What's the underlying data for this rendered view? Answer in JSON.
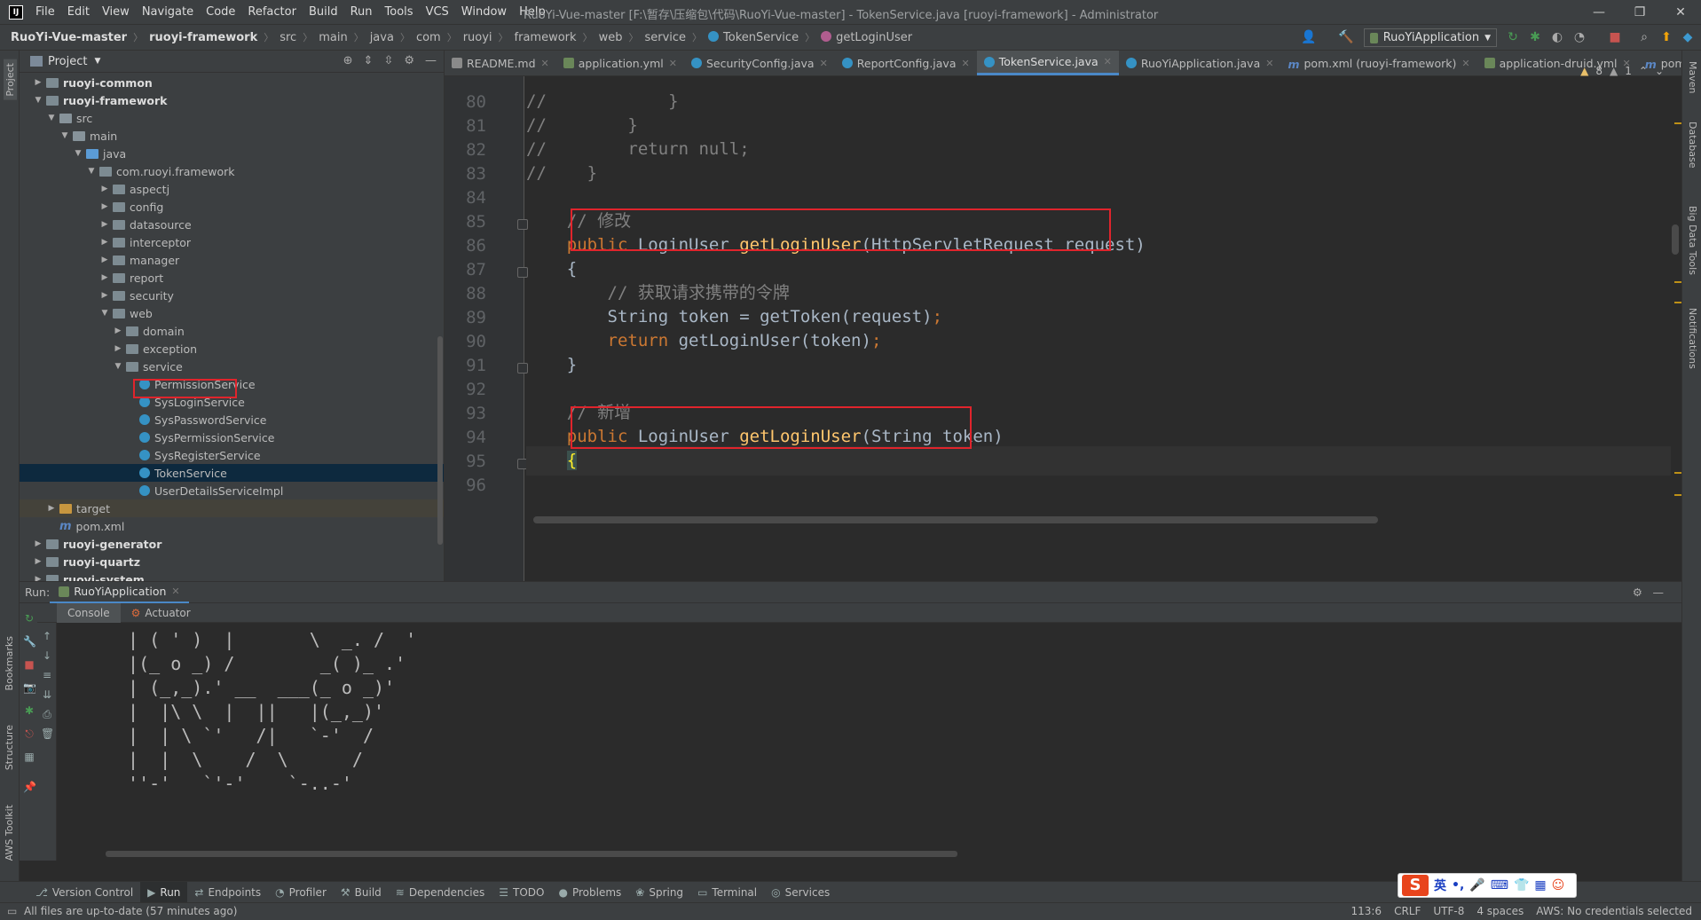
{
  "titlebar": {
    "menus": [
      "File",
      "Edit",
      "View",
      "Navigate",
      "Code",
      "Refactor",
      "Build",
      "Run",
      "Tools",
      "VCS",
      "Window",
      "Help"
    ],
    "title": "RuoYi-Vue-master [F:\\暂存\\压缩包\\代码\\RuoYi-Vue-master] - TokenService.java [ruoyi-framework] - Administrator",
    "controls": [
      "—",
      "❐",
      "✕"
    ]
  },
  "navbar": {
    "breadcrumb": [
      "RuoYi-Vue-master",
      "ruoyi-framework",
      "src",
      "main",
      "java",
      "com",
      "ruoyi",
      "framework",
      "web",
      "service",
      "TokenService",
      "getLoginUser"
    ],
    "run_config": "RuoYiApplication"
  },
  "project": {
    "title": "Project",
    "tree": [
      {
        "label": "ruoyi-common",
        "bold": true,
        "depth": 1,
        "arrow": "›",
        "icon": "mod"
      },
      {
        "label": "ruoyi-framework",
        "bold": true,
        "depth": 1,
        "arrow": "⌄",
        "icon": "mod"
      },
      {
        "label": "src",
        "depth": 2,
        "arrow": "⌄",
        "icon": "folder"
      },
      {
        "label": "main",
        "depth": 3,
        "arrow": "⌄",
        "icon": "folder"
      },
      {
        "label": "java",
        "depth": 4,
        "arrow": "⌄",
        "icon": "blue"
      },
      {
        "label": "com.ruoyi.framework",
        "depth": 5,
        "arrow": "⌄",
        "icon": "pkg"
      },
      {
        "label": "aspectj",
        "depth": 6,
        "arrow": "›",
        "icon": "pkg"
      },
      {
        "label": "config",
        "depth": 6,
        "arrow": "›",
        "icon": "pkg"
      },
      {
        "label": "datasource",
        "depth": 6,
        "arrow": "›",
        "icon": "pkg"
      },
      {
        "label": "interceptor",
        "depth": 6,
        "arrow": "›",
        "icon": "pkg"
      },
      {
        "label": "manager",
        "depth": 6,
        "arrow": "›",
        "icon": "pkg"
      },
      {
        "label": "report",
        "depth": 6,
        "arrow": "›",
        "icon": "pkg"
      },
      {
        "label": "security",
        "depth": 6,
        "arrow": "›",
        "icon": "pkg"
      },
      {
        "label": "web",
        "depth": 6,
        "arrow": "⌄",
        "icon": "pkg"
      },
      {
        "label": "domain",
        "depth": 7,
        "arrow": "›",
        "icon": "pkg"
      },
      {
        "label": "exception",
        "depth": 7,
        "arrow": "›",
        "icon": "pkg"
      },
      {
        "label": "service",
        "depth": 7,
        "arrow": "⌄",
        "icon": "pkg"
      },
      {
        "label": "PermissionService",
        "depth": 8,
        "arrow": "",
        "icon": "class"
      },
      {
        "label": "SysLoginService",
        "depth": 8,
        "arrow": "",
        "icon": "class"
      },
      {
        "label": "SysPasswordService",
        "depth": 8,
        "arrow": "",
        "icon": "class"
      },
      {
        "label": "SysPermissionService",
        "depth": 8,
        "arrow": "",
        "icon": "class"
      },
      {
        "label": "SysRegisterService",
        "depth": 8,
        "arrow": "",
        "icon": "class"
      },
      {
        "label": "TokenService",
        "depth": 8,
        "arrow": "",
        "icon": "class",
        "selected": true
      },
      {
        "label": "UserDetailsServiceImpl",
        "depth": 8,
        "arrow": "",
        "icon": "class"
      },
      {
        "label": "target",
        "depth": 2,
        "arrow": "›",
        "icon": "target",
        "shaded": true
      },
      {
        "label": "pom.xml",
        "depth": 2,
        "arrow": "",
        "icon": "m"
      },
      {
        "label": "ruoyi-generator",
        "bold": true,
        "depth": 1,
        "arrow": "›",
        "icon": "mod"
      },
      {
        "label": "ruoyi-quartz",
        "bold": true,
        "depth": 1,
        "arrow": "›",
        "icon": "mod"
      },
      {
        "label": "ruoyi-system",
        "bold": true,
        "depth": 1,
        "arrow": "›",
        "icon": "mod"
      }
    ]
  },
  "editor": {
    "tabs": [
      {
        "label": "README.md",
        "icon": "md"
      },
      {
        "label": "application.yml",
        "icon": "yml"
      },
      {
        "label": "SecurityConfig.java",
        "icon": "java"
      },
      {
        "label": "ReportConfig.java",
        "icon": "java"
      },
      {
        "label": "TokenService.java",
        "icon": "java",
        "active": true
      },
      {
        "label": "RuoYiApplication.java",
        "icon": "java"
      },
      {
        "label": "pom.xml (ruoyi-framework)",
        "icon": "m"
      },
      {
        "label": "application-druid.yml",
        "icon": "yml"
      },
      {
        "label": "pom.",
        "icon": "m"
      }
    ],
    "inspections": {
      "warnings": "8",
      "weak": "1"
    },
    "lines": [
      {
        "n": "80",
        "parts": [
          [
            "cmt",
            "//            }"
          ]
        ]
      },
      {
        "n": "81",
        "parts": [
          [
            "cmt",
            "//        }"
          ]
        ]
      },
      {
        "n": "82",
        "parts": [
          [
            "cmt",
            "//        return null;"
          ]
        ]
      },
      {
        "n": "83",
        "parts": [
          [
            "cmt",
            "//    }"
          ]
        ]
      },
      {
        "n": "84",
        "parts": []
      },
      {
        "n": "85",
        "parts": [
          [
            "cmt",
            "    // 修改"
          ]
        ]
      },
      {
        "n": "86",
        "parts": [
          [
            "kw",
            "    public "
          ],
          [
            "typ",
            "LoginUser "
          ],
          [
            "fn",
            "getLoginUser"
          ],
          [
            "typ",
            "(HttpServletRequest request)"
          ]
        ]
      },
      {
        "n": "87",
        "parts": [
          [
            "typ",
            "    {"
          ]
        ]
      },
      {
        "n": "88",
        "parts": [
          [
            "cmt",
            "        // 获取请求携带的令牌"
          ]
        ]
      },
      {
        "n": "89",
        "parts": [
          [
            "typ",
            "        String token = getToken(request)"
          ],
          [
            "kw",
            ";"
          ]
        ]
      },
      {
        "n": "90",
        "parts": [
          [
            "kw",
            "        return "
          ],
          [
            "typ",
            "getLoginUser(token)"
          ],
          [
            "kw",
            ";"
          ]
        ]
      },
      {
        "n": "91",
        "parts": [
          [
            "typ",
            "    }"
          ]
        ]
      },
      {
        "n": "92",
        "parts": []
      },
      {
        "n": "93",
        "parts": [
          [
            "cmt",
            "    // 新增"
          ]
        ]
      },
      {
        "n": "94",
        "parts": [
          [
            "kw",
            "    public "
          ],
          [
            "typ",
            "LoginUser "
          ],
          [
            "fn",
            "getLoginUser"
          ],
          [
            "typ",
            "(String token)"
          ]
        ]
      },
      {
        "n": "95",
        "parts": [
          [
            "typ",
            "    "
          ],
          [
            "brace",
            "{"
          ]
        ]
      },
      {
        "n": "96",
        "parts": []
      }
    ]
  },
  "run": {
    "label": "Run:",
    "config": "RuoYiApplication",
    "subtabs": [
      "Console",
      "Actuator"
    ],
    "console_lines": [
      " | ( ' )  |       \\  _. /  '",
      " |(_ o _) /        _( )_ .'",
      " | (_,_).' __  ___(_ o _)'",
      " |  |\\ \\  |  ||   |(_,_)'",
      " |  | \\ `'   /|   `-'  /",
      " |  |  \\    /  \\      /",
      " ''-'   `'-'    `-..-'"
    ]
  },
  "toolwindows": [
    "Version Control",
    "Run",
    "Endpoints",
    "Profiler",
    "Build",
    "Dependencies",
    "TODO",
    "Problems",
    "Spring",
    "Terminal",
    "Services"
  ],
  "left_strip": [
    "Project",
    "Bookmarks",
    "Structure",
    "AWS Toolkit"
  ],
  "right_strip": [
    "Maven",
    "Database",
    "Big Data Tools",
    "Notifications"
  ],
  "status": {
    "message": "All files are up-to-date (57 minutes ago)",
    "right": [
      "113:6",
      "CRLF",
      "UTF-8",
      "4 spaces",
      "AWS: No credentials selected"
    ]
  },
  "ime": {
    "lang": "英",
    "punct": "•,"
  }
}
